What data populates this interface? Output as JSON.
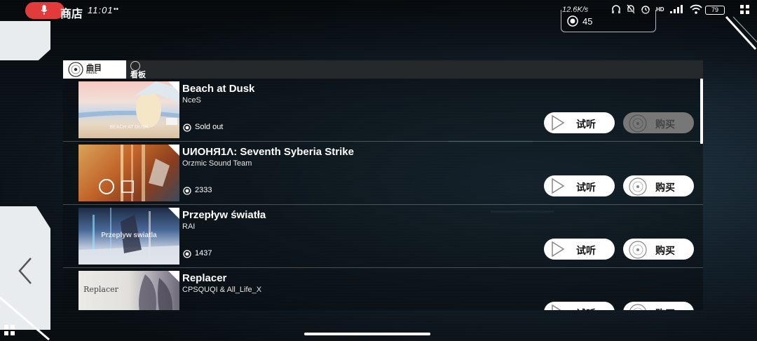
{
  "status_bar": {
    "app_name": "商店",
    "time": "11:01",
    "notif_dots": "••",
    "net_speed": "12.6K/s",
    "hd": "HD",
    "battery": "79"
  },
  "currency": {
    "value": "45"
  },
  "tabs": [
    {
      "label": "曲目",
      "sub": "Music",
      "active": true
    },
    {
      "label": "看板",
      "active": false
    }
  ],
  "songs": [
    {
      "title": "Beach at Dusk",
      "artist": "NceS",
      "price": "Sold out",
      "cover_caption": "BEACH AT DUSK",
      "listen_label": "试听",
      "buy_label": "购买",
      "buy_enabled": false
    },
    {
      "title": "UИOHЯ1Λ: Seventh Syberia Strike",
      "artist": "Orzmic Sound Team",
      "price": "2333",
      "cover_caption": "",
      "listen_label": "试听",
      "buy_label": "购买",
      "buy_enabled": true
    },
    {
      "title": "Przepływ światła",
      "artist": "RAI",
      "price": "1437",
      "cover_caption": "Przeplyw swiatla",
      "listen_label": "试听",
      "buy_label": "购买",
      "buy_enabled": true
    },
    {
      "title": "Replacer",
      "artist": "CPSQUQI & All_Life_X",
      "price": "",
      "cover_caption": "Replacer",
      "listen_label": "试听",
      "buy_label": "购买",
      "buy_enabled": true
    }
  ],
  "colors": {
    "accent_red": "#e23b3b",
    "button_bg": "#ffffff",
    "button_disabled_bg": "#777777"
  },
  "icons": {
    "back": "chevron-left-icon",
    "coin": "disc-icon",
    "play": "play-triangle-icon",
    "buy": "vinyl-disc-icon"
  }
}
